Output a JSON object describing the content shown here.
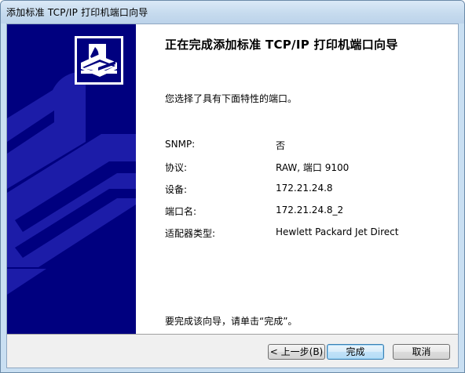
{
  "window": {
    "title": "添加标准 TCP/IP 打印机端口向导"
  },
  "wizard": {
    "heading": "正在完成添加标准 TCP/IP 打印机端口向导",
    "intro": "您选择了具有下面特性的端口。",
    "properties": [
      {
        "label": "SNMP:",
        "value": "否"
      },
      {
        "label": "协议:",
        "value": "RAW, 端口 9100"
      },
      {
        "label": "设备:",
        "value": "172.21.24.8"
      },
      {
        "label": "端口名:",
        "value": "172.21.24.8_2"
      },
      {
        "label": "适配器类型:",
        "value": "Hewlett Packard Jet Direct"
      }
    ],
    "finish_note": "要完成该向导，请单击“完成”。"
  },
  "buttons": {
    "back": "< 上一步(B)",
    "finish": "完成",
    "cancel": "取消"
  },
  "colors": {
    "sidebar": "#00007f",
    "sidebar_art": "#1a1aa6",
    "accent": "#3c7fb1"
  },
  "icons": {
    "logo": "printer-port-icon"
  }
}
